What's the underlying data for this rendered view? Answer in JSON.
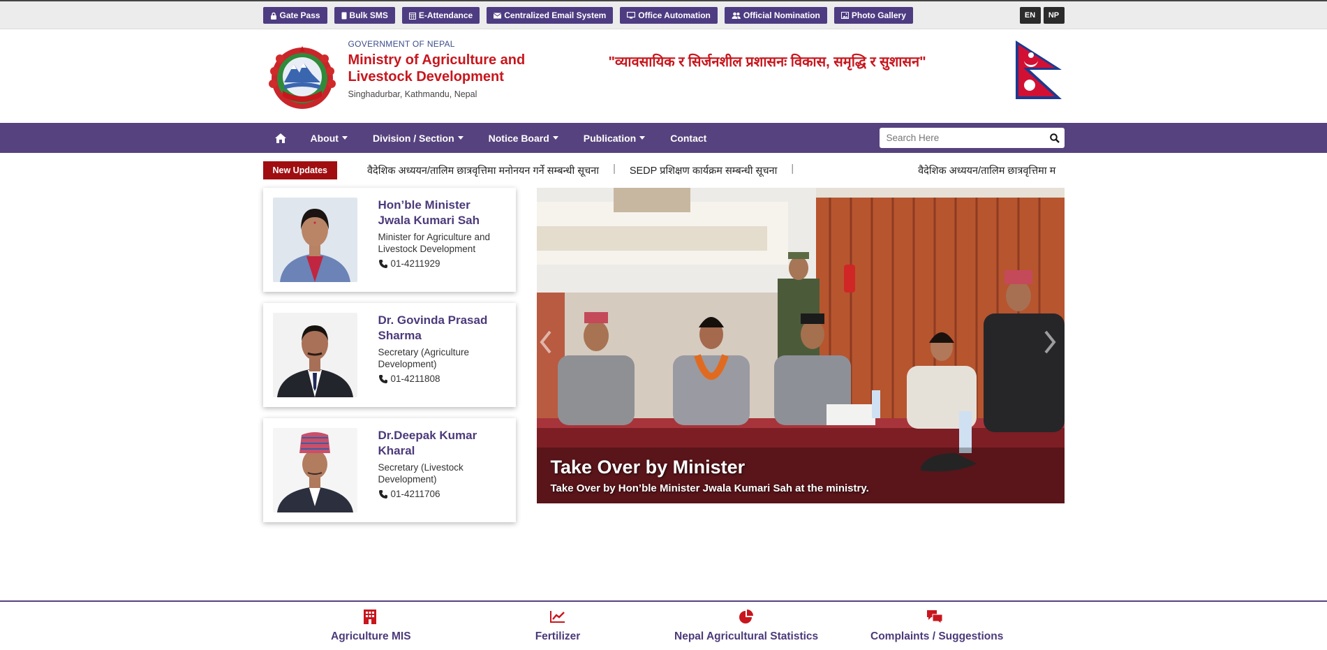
{
  "topbar": {
    "links": [
      {
        "label": "Gate Pass",
        "icon": "lock-icon"
      },
      {
        "label": "Bulk SMS",
        "icon": "mobile-icon"
      },
      {
        "label": "E-Attendance",
        "icon": "calendar-icon"
      },
      {
        "label": "Centralized Email System",
        "icon": "envelope-icon"
      },
      {
        "label": "Office Automation",
        "icon": "desktop-icon"
      },
      {
        "label": "Official Nomination",
        "icon": "users-icon"
      },
      {
        "label": "Photo Gallery",
        "icon": "image-icon"
      }
    ],
    "languages": [
      "EN",
      "NP"
    ]
  },
  "header": {
    "gov_label": "GOVERNMENT OF NEPAL",
    "ministry_name": "Ministry of Agriculture and Livestock Development",
    "address": "Singhadurbar, Kathmandu, Nepal",
    "slogan": "\"व्यावसायिक र सिर्जनशील प्रशासनः विकास, समृद्धि र सुशासन\""
  },
  "nav": {
    "items": [
      "About",
      "Division / Section",
      "Notice Board",
      "Publication",
      "Contact"
    ],
    "search_placeholder": "Search Here"
  },
  "updates": {
    "label": "New Updates",
    "items": [
      "वैदेशिक अध्ययन/तालिम छात्रवृत्तिमा मनोनयन गर्ने सम्बन्धी सूचना",
      "SEDP प्रशिक्षण कार्यक्रम सम्बन्धी सूचना",
      "वैदेशिक अध्ययन/तालिम छात्रवृत्तिमा म"
    ]
  },
  "officials": [
    {
      "name": "Hon’ble Minister Jwala Kumari Sah",
      "designation": "Minister for Agriculture and Livestock Development",
      "phone": "01-4211929"
    },
    {
      "name": "Dr. Govinda Prasad Sharma",
      "designation": "Secretary (Agriculture Development)",
      "phone": "01-4211808"
    },
    {
      "name": "Dr.Deepak Kumar Kharal",
      "designation": "Secretary (Livestock Development)",
      "phone": "01-4211706"
    }
  ],
  "slider": {
    "title": "Take Over by Minister",
    "caption": "Take Over by  Hon’ble Minister Jwala Kumari Sah at the ministry."
  },
  "services": [
    {
      "label": "Agriculture MIS",
      "icon": "building-icon"
    },
    {
      "label": "Fertilizer",
      "icon": "line-chart-icon"
    },
    {
      "label": "Nepal Agricultural Statistics",
      "icon": "pie-chart-icon"
    },
    {
      "label": "Complaints / Suggestions",
      "icon": "comments-icon"
    }
  ],
  "colors": {
    "brand_purple": "#56427e",
    "brand_red": "#c8161d",
    "update_red": "#a00e12"
  }
}
